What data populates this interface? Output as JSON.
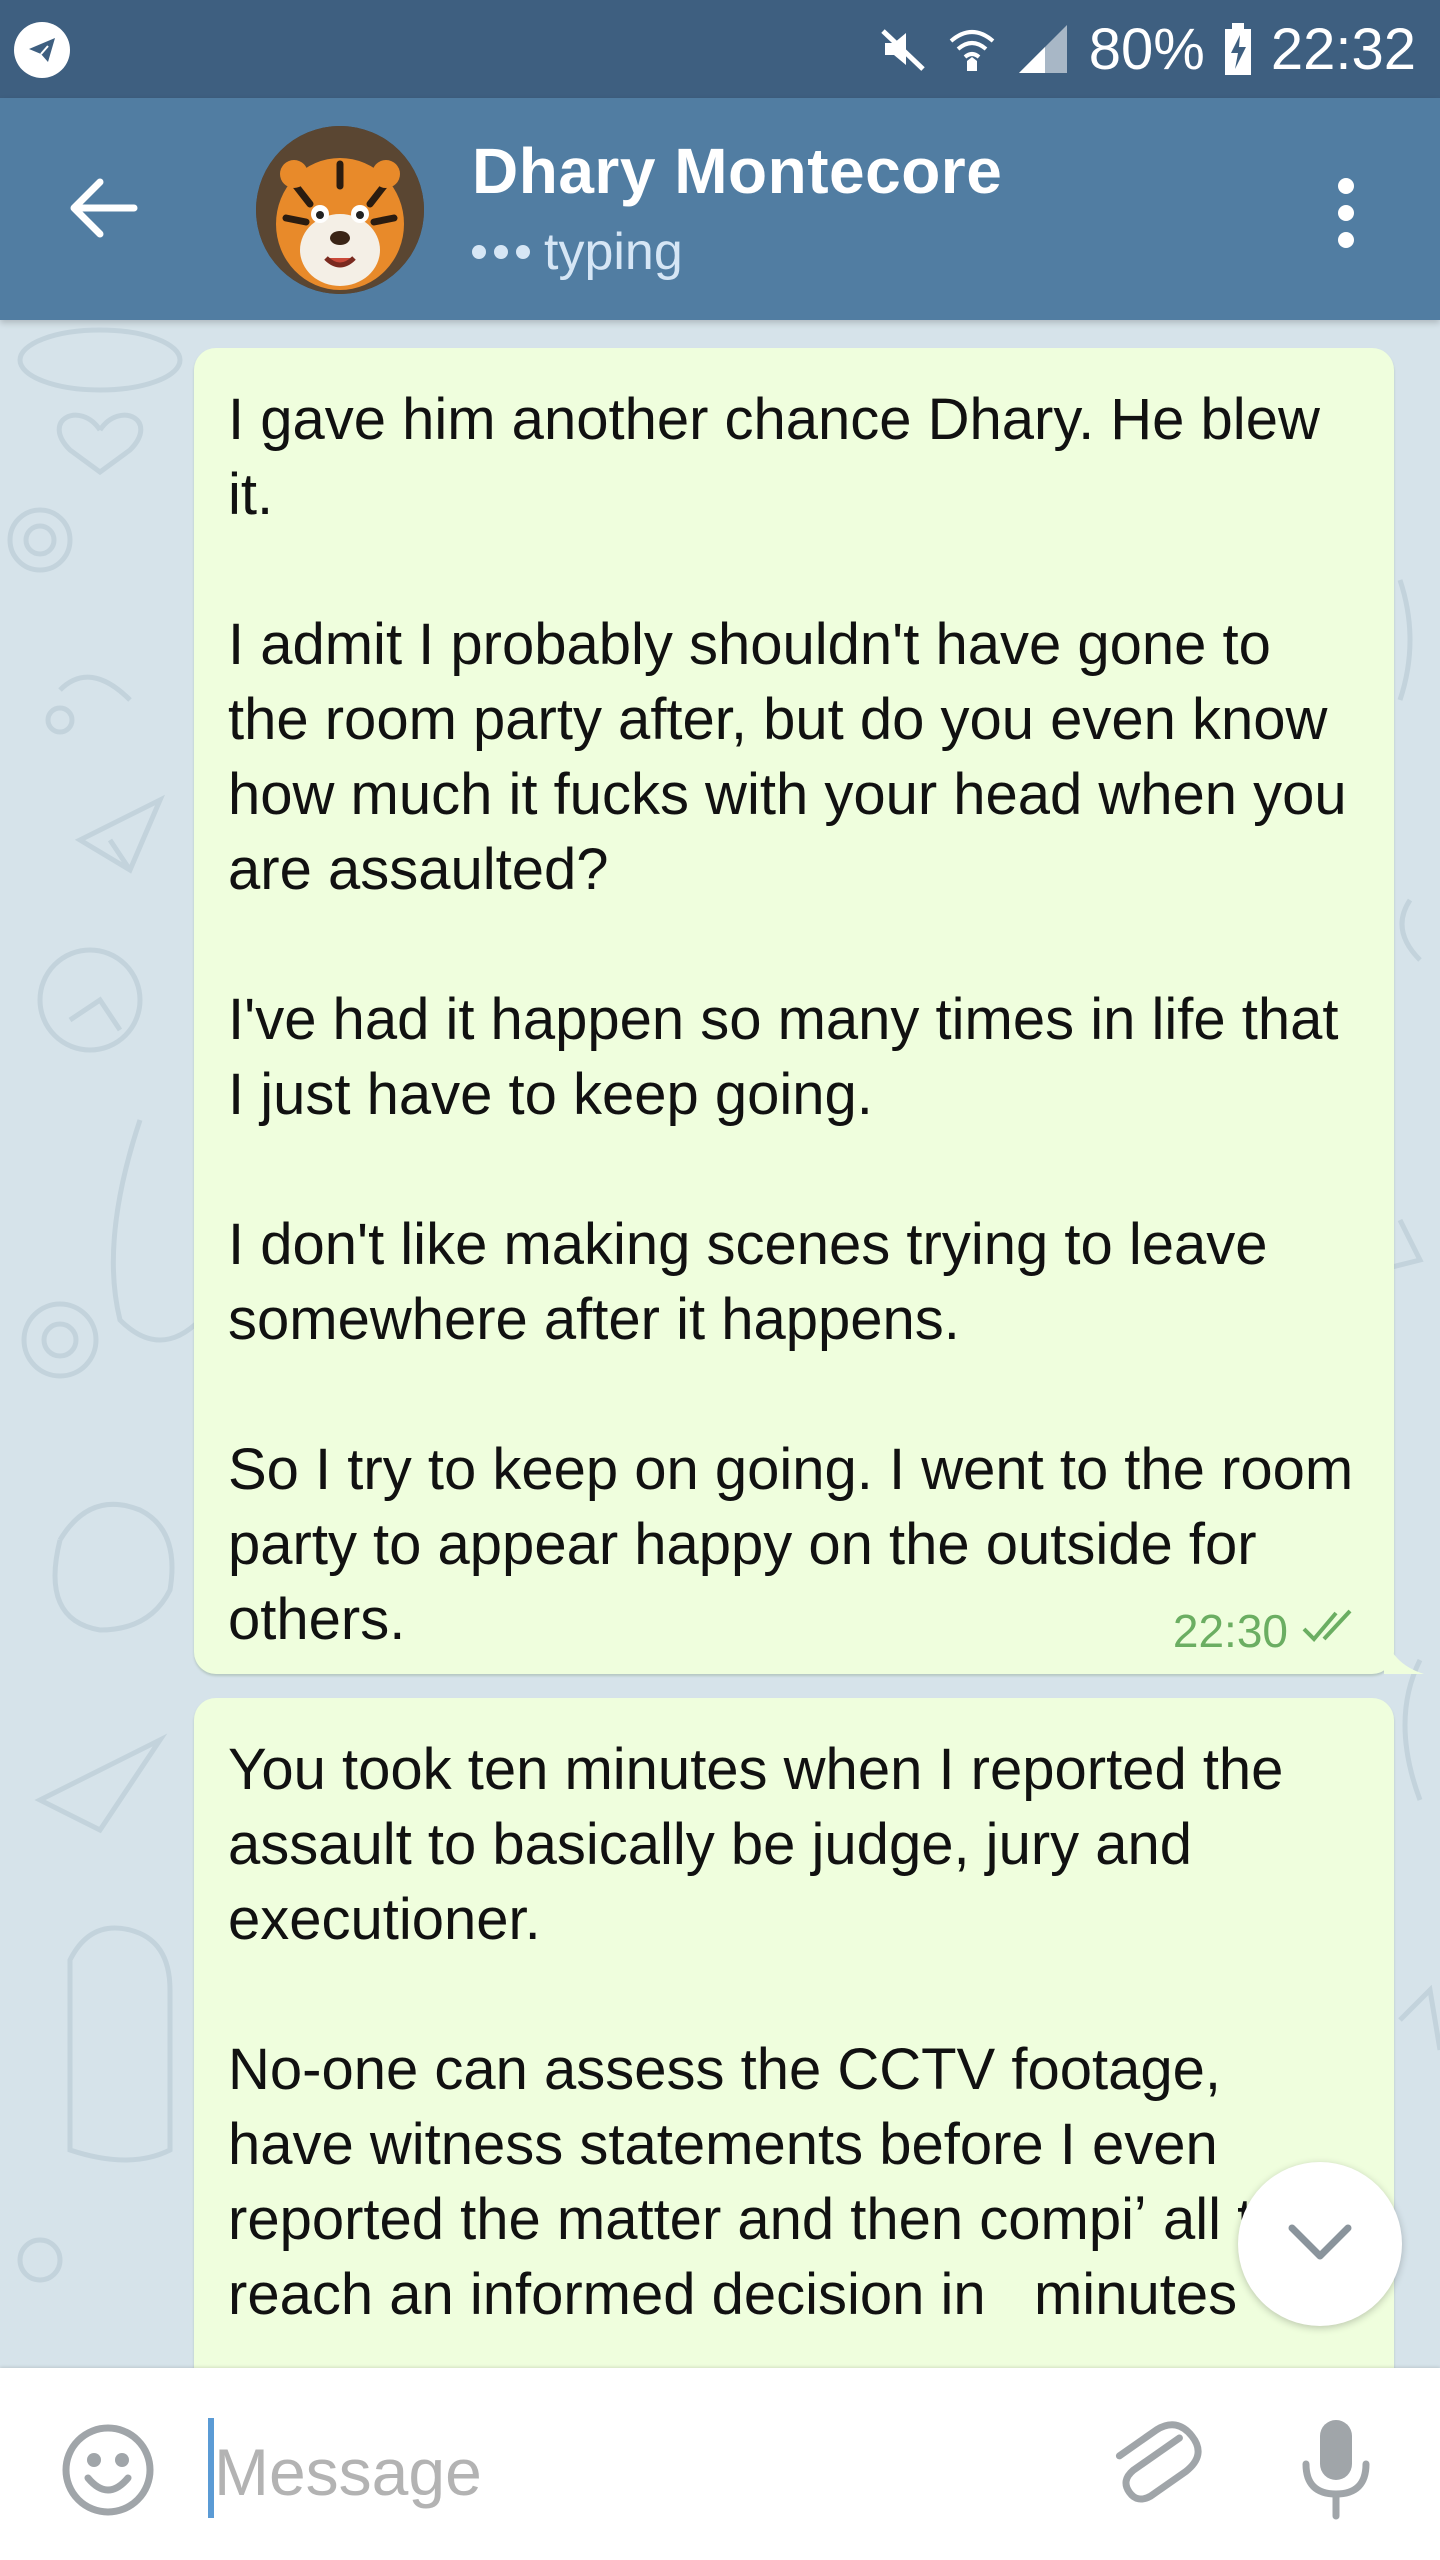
{
  "status_bar": {
    "battery": "80%",
    "time": "22:32",
    "icons": [
      "telegram-icon",
      "mute-icon",
      "wifi-icon",
      "signal-icon",
      "battery-charging-icon"
    ]
  },
  "header": {
    "contact_name": "Dhary Montecore",
    "status": "typing",
    "icons": [
      "back-arrow-icon",
      "avatar-tiger",
      "more-vert-icon"
    ]
  },
  "messages": [
    {
      "text": "I gave him another chance Dhary. He blew it.\n\nI admit I probably shouldn't have gone to the room party after, but do you even know how much it fucks with your head when you are assaulted?\n\nI've had it happen so many times in life that I just have to keep going.\n\nI don't like making scenes trying to leave somewhere after it happens.\n\nSo I try to keep on going. I went to the room party to appear happy on the outside for others.",
      "time": "22:30",
      "read_status": "double-check-icon"
    },
    {
      "text": "You took ten minutes when I reported the assault to basically be judge, jury and executioner.\n\nNo-one can assess the CCTV footage, have witness statements before I even reported the matter and then compiʼ all to reach an informed decision in   minutes",
      "time": "",
      "read_status": "double-check-icon"
    }
  ],
  "input": {
    "placeholder": "Message",
    "value": ""
  },
  "colors": {
    "status_bar": "#3e5f80",
    "header": "#517da2",
    "chat_bg": "#d6e3ea",
    "outgoing_bubble": "#effedd",
    "time_green": "#6bae62",
    "caret": "#5b9bd5"
  }
}
